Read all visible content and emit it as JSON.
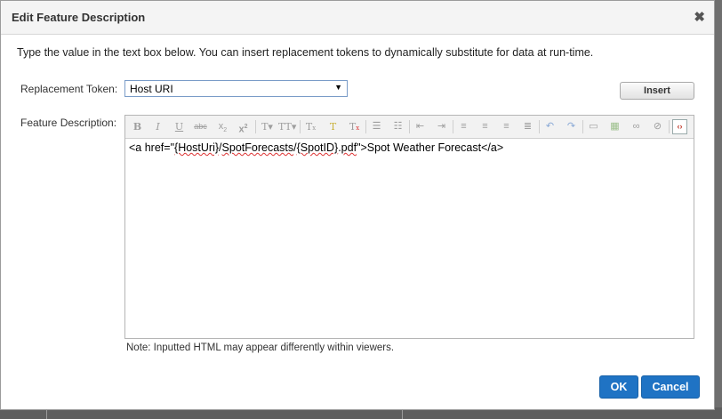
{
  "dialog": {
    "title": "Edit Feature Description",
    "close_icon": "close-icon",
    "instruction": "Type the value in the text box below. You can insert replacement tokens to dynamically substitute for data at run-time."
  },
  "token": {
    "label": "Replacement Token:",
    "selected": "Host URI",
    "insert_label": "Insert"
  },
  "description": {
    "label": "Feature Description:",
    "toolbar": [
      "bold-icon",
      "italic-icon",
      "underline-icon",
      "strikethrough-icon",
      "subscript-icon",
      "superscript-icon",
      "font-icon",
      "font-size-icon",
      "remove-format-icon",
      "highlight-icon",
      "clear-format-icon",
      "bulleted-list-icon",
      "numbered-list-icon",
      "outdent-icon",
      "indent-icon",
      "align-left-icon",
      "align-center-icon",
      "align-right-icon",
      "justify-icon",
      "undo-icon",
      "redo-icon",
      "horizontal-rule-icon",
      "image-icon",
      "link-icon",
      "unlink-icon",
      "source-code-icon"
    ],
    "content_parts": [
      "<a href=\"",
      "{HostUri}",
      "/",
      "SpotForecasts",
      "/",
      "{SpotID}",
      ".",
      "pdf",
      "\">Spot Weather Forecast</a>"
    ],
    "note": "Note: Inputted HTML may appear differently within viewers."
  },
  "footer": {
    "ok_label": "OK",
    "cancel_label": "Cancel"
  },
  "colors": {
    "primary_button": "#1f73c4"
  }
}
